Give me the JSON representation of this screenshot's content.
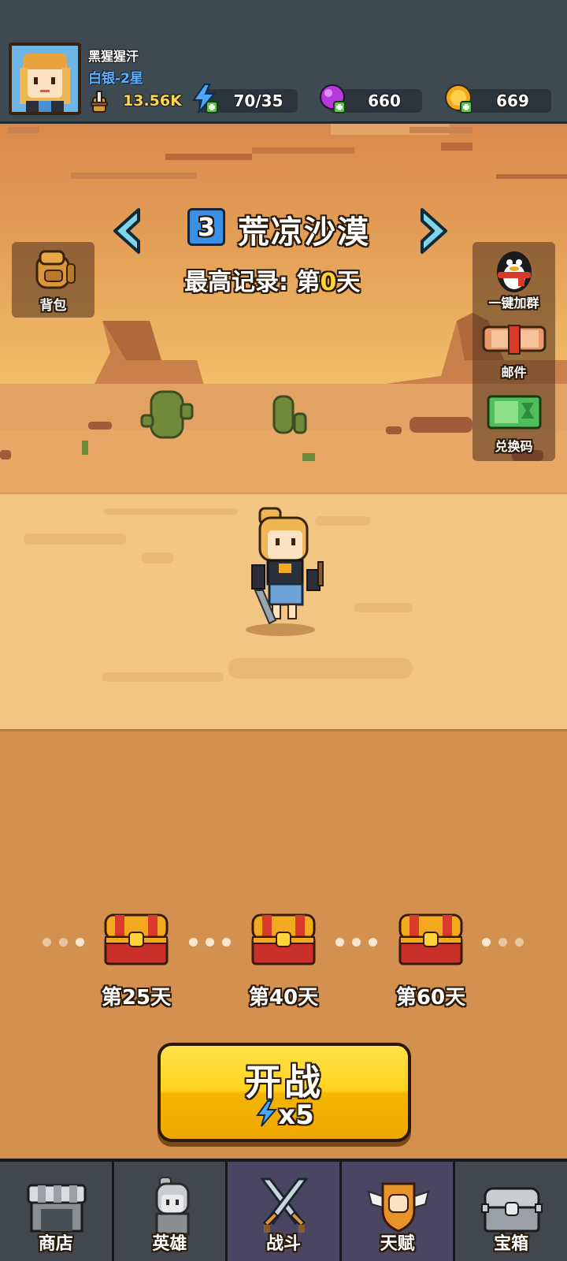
{
  "player": {
    "name": "黑猩猩汗",
    "rank": "白银-2星",
    "power": "13.56K"
  },
  "resources": {
    "energy": "70/35",
    "gems": "660",
    "coins": "669"
  },
  "stage": {
    "number": "3",
    "name": "荒凉沙漠",
    "best_record_prefix": "最高记录: 第",
    "best_record_value": "0",
    "best_record_suffix": "天"
  },
  "side_buttons": {
    "bag": "背包",
    "join_group": "一键加群",
    "mail": "邮件",
    "redeem": "兑换码"
  },
  "chests": [
    {
      "label": "第25天"
    },
    {
      "label": "第40天"
    },
    {
      "label": "第60天"
    }
  ],
  "start_button": {
    "title": "开战",
    "cost": "x5"
  },
  "nav": [
    {
      "label": "商店",
      "icon": "shop-icon"
    },
    {
      "label": "英雄",
      "icon": "hero-icon"
    },
    {
      "label": "战斗",
      "icon": "crossed-swords-icon"
    },
    {
      "label": "天赋",
      "icon": "talent-fist-icon"
    },
    {
      "label": "宝箱",
      "icon": "treasure-chest-icon"
    }
  ],
  "colors": {
    "topbar": "#3d4a52",
    "accent_yellow": "#ffd21e",
    "rank_blue": "#5fb0ff",
    "stage_badge": "#3a8fe6"
  }
}
